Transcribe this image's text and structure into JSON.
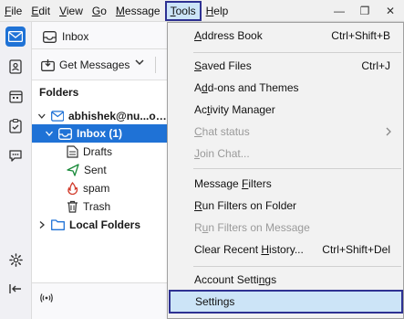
{
  "menubar": {
    "items": [
      {
        "label": "File",
        "u": "F",
        "rest": "ile"
      },
      {
        "label": "Edit",
        "u": "E",
        "rest": "dit"
      },
      {
        "label": "View",
        "u": "V",
        "rest": "iew"
      },
      {
        "label": "Go",
        "u": "G",
        "rest": "o"
      },
      {
        "label": "Message",
        "u": "M",
        "rest": "essage"
      },
      {
        "label": "Tools",
        "u": "T",
        "rest": "ools"
      },
      {
        "label": "Help",
        "u": "H",
        "rest": "elp"
      }
    ],
    "window_controls": {
      "minimize": "—",
      "restore": "❐",
      "close": "✕"
    }
  },
  "tab": {
    "label": "Inbox"
  },
  "toolbar": {
    "get_messages": "Get Messages"
  },
  "folders": {
    "header": "Folders",
    "account": "abhishek@nu...ology.com",
    "inbox": "Inbox (1)",
    "drafts": "Drafts",
    "sent": "Sent",
    "spam": "spam",
    "trash": "Trash",
    "local": "Local Folders"
  },
  "tools_menu": {
    "address_book": {
      "u": "A",
      "rest": "ddress Book",
      "shortcut": "Ctrl+Shift+B"
    },
    "saved_files": {
      "u": "S",
      "pre": "",
      "rest": "aved Files",
      "shortcut": "Ctrl+J"
    },
    "addons": {
      "u": "d",
      "pre": "A",
      "rest": "d-ons and Themes"
    },
    "activity": {
      "pre": "Ac",
      "u": "t",
      "rest": "ivity Manager"
    },
    "chat_status": {
      "u": "C",
      "rest": "hat status"
    },
    "join_chat": {
      "u": "J",
      "rest": "oin Chat..."
    },
    "message_filters": {
      "pre": "Message ",
      "u": "F",
      "rest": "ilters"
    },
    "run_filters": {
      "u": "R",
      "rest": "un Filters on Folder"
    },
    "run_filters_msg": {
      "pre": "R",
      "u": "u",
      "rest": "n Filters on Message"
    },
    "clear_history": {
      "pre": "Clear Recent ",
      "u": "H",
      "rest": "istory...",
      "shortcut": "Ctrl+Shift+Del"
    },
    "account_settings": {
      "pre": "Account Setti",
      "u": "n",
      "rest": "gs"
    },
    "settings": {
      "pre": "Settin",
      "u": "g",
      "rest": "s"
    }
  },
  "colors": {
    "accent": "#1f72d6",
    "highlight_border": "#2e3192",
    "highlight_bg": "#cce4f7"
  }
}
